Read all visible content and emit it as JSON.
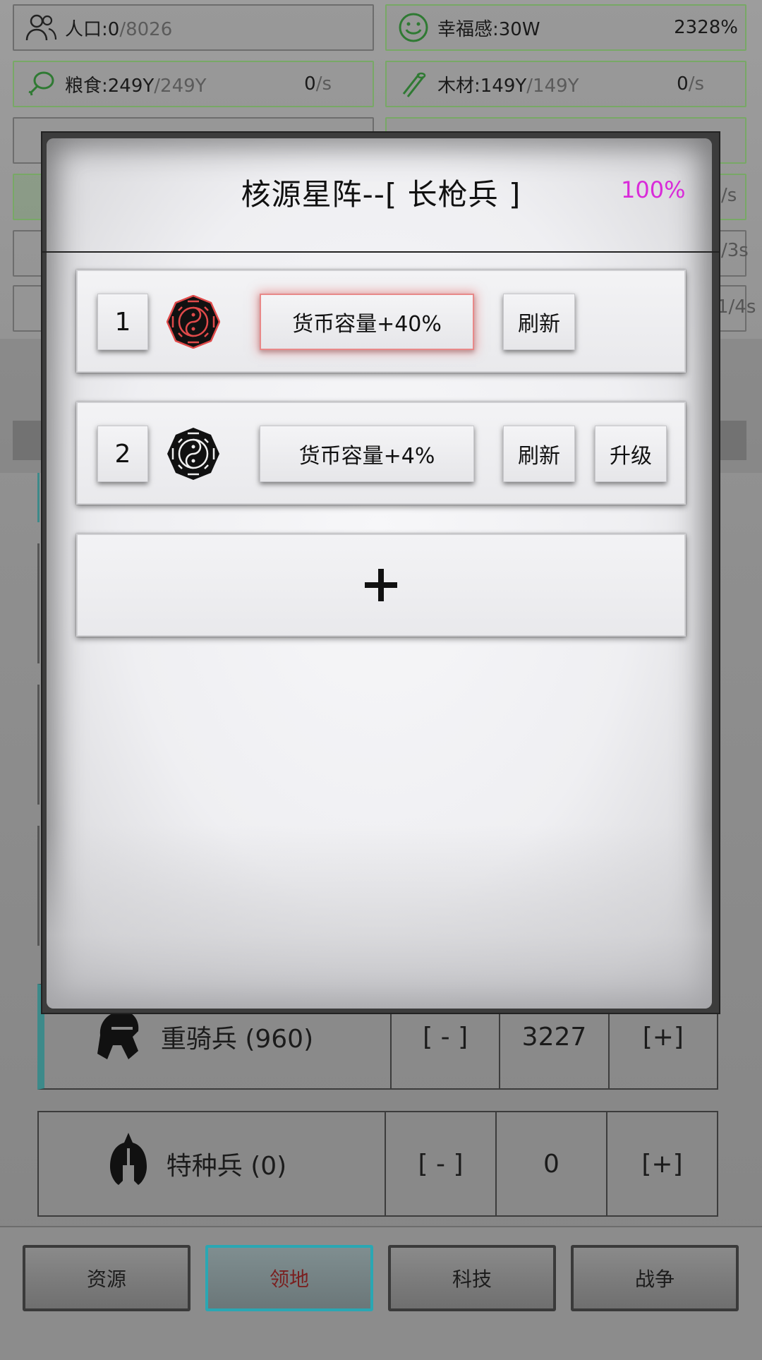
{
  "resources": {
    "population": {
      "label": "人口:0",
      "max": "/8026"
    },
    "happiness": {
      "label": "幸福感:30W",
      "percent": "2328%"
    },
    "food": {
      "label": "粮食:249Y",
      "max": "/249Y",
      "rate": "0",
      "rate_unit": "/s"
    },
    "wood": {
      "label": "木材:149Y",
      "max": "/149Y",
      "rate": "0",
      "rate_unit": "/s"
    }
  },
  "bg_fragments": {
    "right_edge_1": "/s",
    "right_edge_2": "/3s",
    "right_edge_3": "1/4s"
  },
  "units": [
    {
      "name": "重骑兵 (960)",
      "minus": "[ - ]",
      "count": "3227",
      "plus": "[+]"
    },
    {
      "name": "特种兵 (0)",
      "minus": "[ - ]",
      "count": "0",
      "plus": "[+]"
    }
  ],
  "nav": {
    "resources": "资源",
    "territory": "领地",
    "tech": "科技",
    "war": "战争"
  },
  "modal": {
    "title": "核源星阵--[ 长枪兵 ]",
    "percent": "100%",
    "slots": [
      {
        "index": "1",
        "stat": "货币容量+40%",
        "refresh": "刷新",
        "upgrade": ""
      },
      {
        "index": "2",
        "stat": "货币容量+4%",
        "refresh": "刷新",
        "upgrade": "升级"
      }
    ]
  },
  "colors": {
    "percent_magenta": "#d92bd9",
    "active_tab_border": "#2aa7b3",
    "resource_border": "#78a866"
  },
  "icons": {
    "population": "people-icon",
    "happiness": "smile-icon",
    "food": "meat-icon",
    "wood": "wood-icon",
    "slot1": "bagua-red-icon",
    "slot2": "bagua-black-icon",
    "unit1": "knight-helmet-icon",
    "unit2": "spartan-helmet-icon",
    "add": "plus-icon"
  }
}
